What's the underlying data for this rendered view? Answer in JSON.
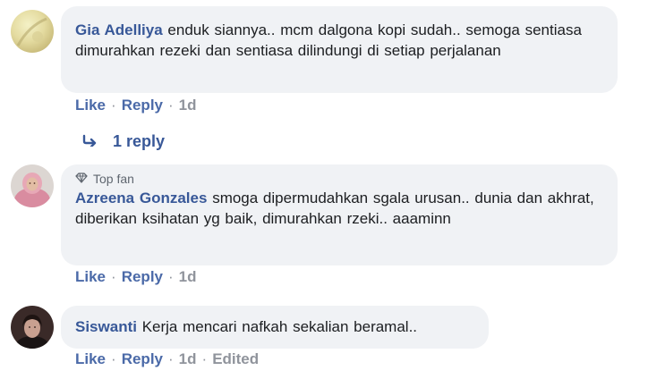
{
  "comments": [
    {
      "author": "Gia Adelliya",
      "text": "enduk siannya.. mcm dalgona kopi sudah.. semoga sentiasa dimurahkan rezeki dan sentiasa dilindungi di setiap perjalanan",
      "actions": {
        "like": "Like",
        "reply": "Reply",
        "time": "1d"
      },
      "replies_label": "1 reply"
    },
    {
      "badge": "Top fan",
      "author": "Azreena Gonzales",
      "text": "smoga dipermudahkan sgala urusan.. dunia dan akhrat, diberikan ksihatan yg baik, dimurahkan rzeki.. aaaminn",
      "actions": {
        "like": "Like",
        "reply": "Reply",
        "time": "1d"
      }
    },
    {
      "author": "Siswanti",
      "text": "Kerja mencari nafkah sekalian beramal..",
      "actions": {
        "like": "Like",
        "reply": "Reply",
        "time": "1d",
        "edited": "Edited"
      }
    }
  ],
  "separator": "·",
  "icons": {
    "reply_arrow": "reply-arrow-icon",
    "top_fan": "diamond-icon"
  }
}
